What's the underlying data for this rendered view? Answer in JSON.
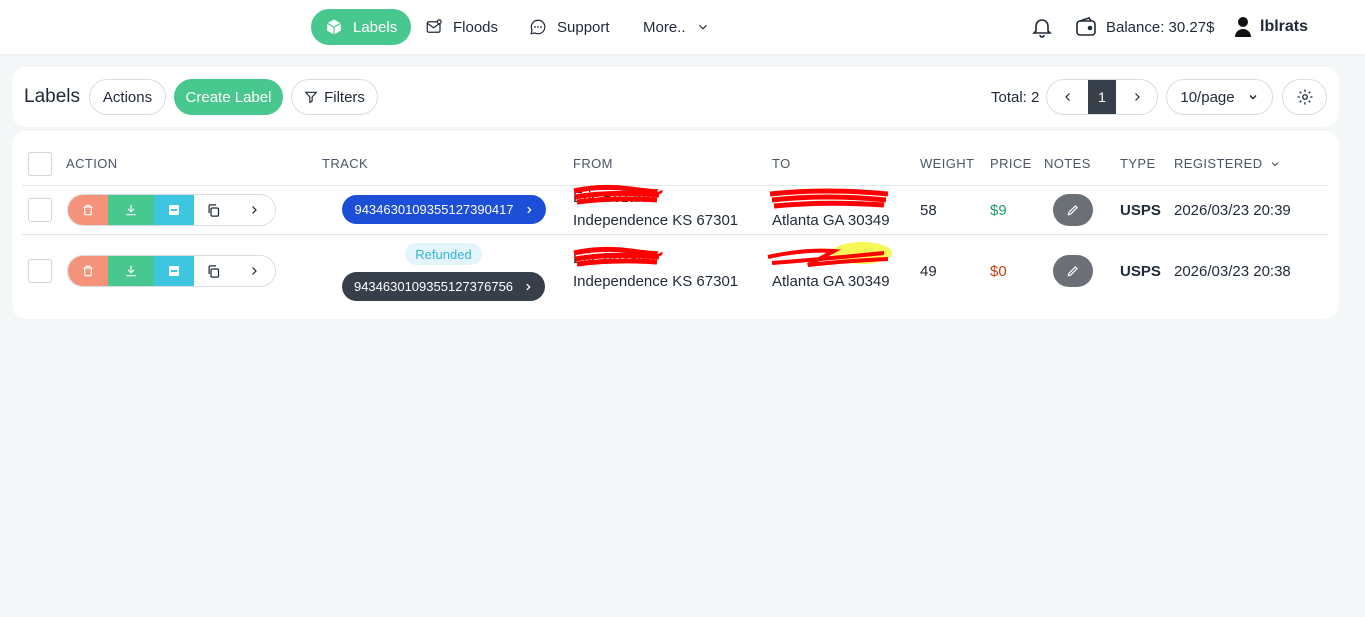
{
  "nav": {
    "items": [
      {
        "label": "Labels",
        "icon": "box-icon",
        "active": true
      },
      {
        "label": "Floods",
        "icon": "mail-icon"
      },
      {
        "label": "Support",
        "icon": "chat-icon"
      },
      {
        "label": "More..",
        "icon": "chevron-down-icon"
      }
    ],
    "balance": "Balance: 30.27$",
    "username": "lblrats"
  },
  "toolbar": {
    "title": "Labels",
    "actions_label": "Actions",
    "create_label": "Create Label",
    "filters_label": "Filters",
    "total": "Total: 2",
    "current_page": "1",
    "per_page": "10/page"
  },
  "table": {
    "headers": {
      "action": "ACTION",
      "track": "TRACK",
      "from": "FROM",
      "to": "TO",
      "weight": "WEIGHT",
      "price": "PRICE",
      "notes": "NOTES",
      "type": "TYPE",
      "registered": "REGISTERED"
    },
    "rows": [
      {
        "track": "9434630109355127390417",
        "status": "",
        "from_name": "Eric Bozarth",
        "from_city": "Independence KS 67301",
        "to_name": "",
        "to_city": "Atlanta GA 30349",
        "weight": "58",
        "price": "$9",
        "type": "USPS",
        "registered": "2026/03/23 20:39"
      },
      {
        "track": "9434630109355127376756",
        "status": "Refunded",
        "from_name": "Eric Bozarth",
        "from_city": "Independence KS 67301",
        "to_name": "",
        "to_city": "Atlanta GA 30349",
        "weight": "49",
        "price": "$0",
        "type": "USPS",
        "registered": "2026/03/23 20:38"
      }
    ]
  },
  "colors": {
    "green": "#48c78e",
    "blue_track": "#1d4ed8",
    "dark_track": "#363f4a",
    "price_positive": "#1f9d6b",
    "price_zero": "#c2410c",
    "redaction": "#ff0000"
  }
}
